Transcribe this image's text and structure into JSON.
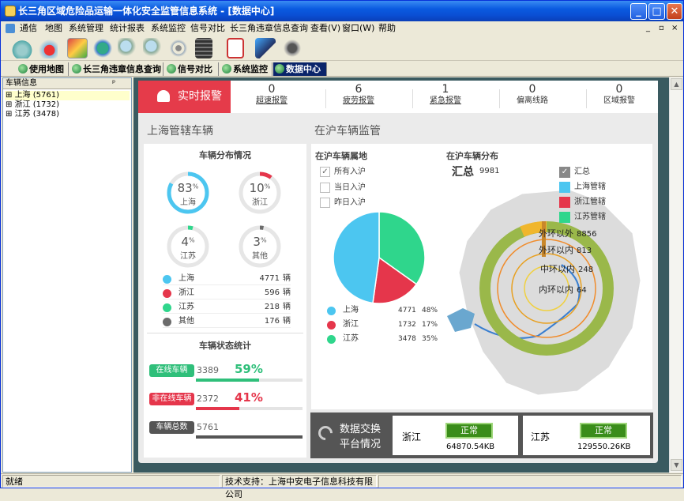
{
  "window": {
    "title": "长三角区域危险品运输一体化安全监管信息系统 - [数据中心]"
  },
  "menu": [
    "通信",
    "地图",
    "系统管理",
    "统计报表",
    "系统监控",
    "信号对比",
    "长三角违章信息查询",
    "查看(V)",
    "窗口(W)",
    "帮助"
  ],
  "tabs": [
    {
      "label": "使用地图",
      "active": false
    },
    {
      "label": "长三角违章信息查询",
      "active": false
    },
    {
      "label": "信号对比",
      "active": false
    },
    {
      "label": "系统监控",
      "active": false
    },
    {
      "label": "数据中心",
      "active": true
    }
  ],
  "left_panel": {
    "title": "车辆信息",
    "pin": "ᵖ",
    "tree": [
      "上海 (5761)",
      "浙江 (1732)",
      "江苏 (3478)"
    ]
  },
  "alerts": {
    "main_label": "实时报警",
    "items": [
      {
        "count": "0",
        "label": "超速报警",
        "underline": true
      },
      {
        "count": "6",
        "label": "疲劳报警",
        "underline": true
      },
      {
        "count": "1",
        "label": "紧急报警",
        "underline": true
      },
      {
        "count": "0",
        "label": "偏离线路",
        "underline": false
      },
      {
        "count": "0",
        "label": "区域报警",
        "underline": false
      }
    ]
  },
  "sh_section": {
    "title": "上海管辖车辆",
    "dist_title": "车辆分布情况",
    "donuts": [
      {
        "pct": "83",
        "unit": "%",
        "name": "上海",
        "value": 0.83,
        "color": "#4cc6f0"
      },
      {
        "pct": "10",
        "unit": "%",
        "name": "浙江",
        "value": 0.1,
        "color": "#e5364b"
      },
      {
        "pct": "4",
        "unit": "%",
        "name": "江苏",
        "value": 0.04,
        "color": "#2fd68c"
      },
      {
        "pct": "3",
        "unit": "%",
        "name": "其他",
        "value": 0.03,
        "color": "#6b6b6b"
      }
    ],
    "legend": [
      {
        "name": "上海",
        "count": "4771",
        "unit": "辆",
        "color": "#4cc6f0"
      },
      {
        "name": "浙江",
        "count": "596",
        "unit": "辆",
        "color": "#e5364b"
      },
      {
        "name": "江苏",
        "count": "218",
        "unit": "辆",
        "color": "#2fd68c"
      },
      {
        "name": "其他",
        "count": "176",
        "unit": "辆",
        "color": "#6b6b6b"
      }
    ],
    "status_title": "车辆状态统计",
    "status": [
      {
        "label": "在线车辆",
        "count": "3389",
        "pct": "59%",
        "fraction": 0.59,
        "color": "#2fbf7a",
        "pct_color": "#2fbf7a"
      },
      {
        "label": "非在线车辆",
        "count": "2372",
        "pct": "41%",
        "fraction": 0.41,
        "color": "#e5364b",
        "pct_color": "#e5364b"
      },
      {
        "label": "车辆总数",
        "count": "5761",
        "pct": "",
        "fraction": 1.0,
        "color": "#555555",
        "pct_color": "#555555"
      }
    ]
  },
  "zsh_section": {
    "title": "在沪车辆监管",
    "origin_title": "在沪车辆属地",
    "filters": [
      {
        "label": "所有入沪",
        "checked": true
      },
      {
        "label": "当日入沪",
        "checked": false
      },
      {
        "label": "昨日入沪",
        "checked": false
      }
    ],
    "pie_legend": [
      {
        "name": "上海",
        "count": "4771",
        "pct": "48%",
        "color": "#4cc6f0"
      },
      {
        "name": "浙江",
        "count": "1732",
        "pct": "17%",
        "color": "#e5364b"
      },
      {
        "name": "江苏",
        "count": "3478",
        "pct": "35%",
        "color": "#2fd68c"
      }
    ],
    "map_title": "在沪车辆分布",
    "total_label": "汇总",
    "total_value": "9981",
    "map_legend": [
      {
        "label": "汇总",
        "color": "#888888",
        "check": true
      },
      {
        "label": "上海管辖",
        "color": "#4cc6f0",
        "check": false
      },
      {
        "label": "浙江管辖",
        "color": "#e5364b",
        "check": false
      },
      {
        "label": "江苏管辖",
        "color": "#2fd68c",
        "check": false
      }
    ],
    "rings": [
      {
        "label": "外环以外",
        "value": "8856"
      },
      {
        "label": "外环以内",
        "value": "813"
      },
      {
        "label": "中环以内",
        "value": "248"
      },
      {
        "label": "内环以内",
        "value": "64"
      }
    ]
  },
  "chart_data": {
    "type": "pie",
    "title": "在沪车辆属地",
    "categories": [
      "上海",
      "浙江",
      "江苏"
    ],
    "values": [
      4771,
      1732,
      3478
    ],
    "percent": [
      48,
      17,
      35
    ],
    "colors": [
      "#4cc6f0",
      "#e5364b",
      "#2fd68c"
    ]
  },
  "exchange": {
    "title_line1": "数据交换",
    "title_line2": "平台情况",
    "nodes": [
      {
        "name": "浙江",
        "status": "正常",
        "size": "64870.54KB"
      },
      {
        "name": "江苏",
        "status": "正常",
        "size": "129550.26KB"
      }
    ]
  },
  "statusbar": {
    "left": "就绪",
    "support": "技术支持：上海中安电子信息科技有限公司"
  }
}
